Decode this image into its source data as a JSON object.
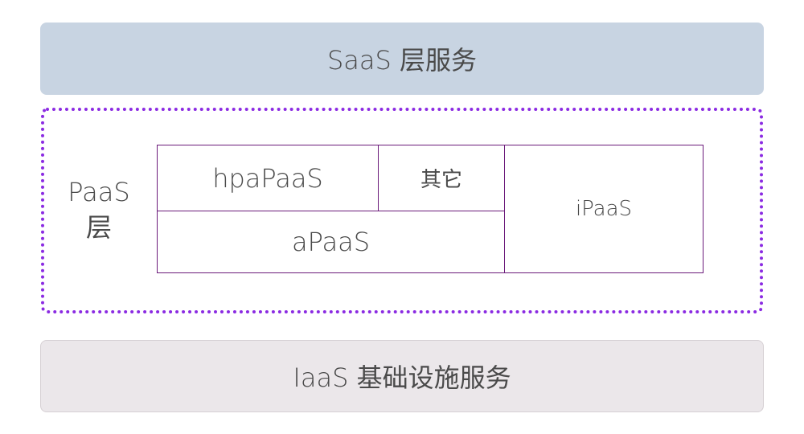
{
  "saas": {
    "label": "SaaS 层服务"
  },
  "paas": {
    "label_line1": "PaaS",
    "label_line2": "层",
    "cells": {
      "hpapaas": "hpaPaaS",
      "other": "其它",
      "apaas": "aPaaS",
      "ipaas": "iPaaS"
    },
    "frame_color": "#8b2be2",
    "cell_border_color": "#6b1a7a"
  },
  "iaas": {
    "label": "IaaS 基础设施服务"
  },
  "colors": {
    "saas_bg": "#c8d4e2",
    "iaas_bg": "#ebe7ea"
  }
}
